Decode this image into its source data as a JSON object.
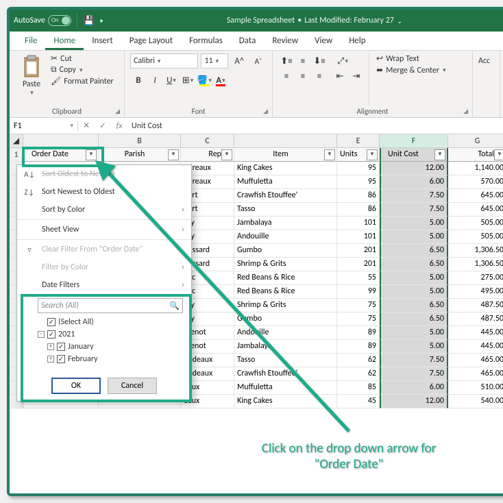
{
  "titlebar": {
    "autosave": "AutoSave",
    "toggle_state": "On",
    "doc_name": "Sample Spreadsheet",
    "modified": "Last Modified: February 27"
  },
  "menu": {
    "file": "File",
    "home": "Home",
    "insert": "Insert",
    "pagelayout": "Page Layout",
    "formulas": "Formulas",
    "data": "Data",
    "review": "Review",
    "view": "View",
    "help": "Help"
  },
  "ribbon": {
    "paste": "Paste",
    "cut": "Cut",
    "copy": "Copy",
    "format_painter": "Format Painter",
    "clipboard": "Clipboard",
    "font_name": "Calibri",
    "font_size": "11",
    "font_group": "Font",
    "wrap": "Wrap Text",
    "merge": "Merge & Center",
    "align_group": "Alignment",
    "acc": "Acc"
  },
  "fx": {
    "cell": "F1",
    "value": "Unit Cost"
  },
  "cols": {
    "b": "B",
    "c": "C",
    "e": "E",
    "f": "F",
    "g": "G"
  },
  "headers": {
    "order_date": "Order Date",
    "parish": "Parish",
    "rep": "Rep",
    "item": "Item",
    "units": "Units",
    "unit_cost": "Unit Cost",
    "total": "Total"
  },
  "rows": [
    {
      "rep": "udreaux",
      "item": "King Cakes",
      "units": 95,
      "cost": "12.00",
      "total": "1,140.00"
    },
    {
      "rep": "udreaux",
      "item": "Muffuletta",
      "units": 95,
      "cost": "6.00",
      "total": "570.00"
    },
    {
      "rep": "bert",
      "item": "Crawfish Etouffee'",
      "units": 86,
      "cost": "7.50",
      "total": "645.00"
    },
    {
      "rep": "bert",
      "item": "Tasso",
      "units": 86,
      "cost": "7.50",
      "total": "645.00"
    },
    {
      "rep": "dry",
      "item": "Jambalaya",
      "units": 101,
      "cost": "5.00",
      "total": "505.00"
    },
    {
      "rep": "dry",
      "item": "Andouille",
      "units": 101,
      "cost": "5.00",
      "total": "505.00"
    },
    {
      "rep": "oussard",
      "item": "Gumbo",
      "units": 201,
      "cost": "6.50",
      "total": "1,306.50"
    },
    {
      "rep": "oussard",
      "item": "Shrimp & Grits",
      "units": 201,
      "cost": "6.50",
      "total": "1,306.50"
    },
    {
      "rep": "anc",
      "item": "Red Beans & Rice",
      "units": 55,
      "cost": "5.00",
      "total": "275.00"
    },
    {
      "rep": "anc",
      "item": "Red Beans & Rice",
      "units": 99,
      "cost": "5.00",
      "total": "495.00"
    },
    {
      "rep": "dry",
      "item": "Shrimp & Grits",
      "units": 75,
      "cost": "6.50",
      "total": "487.50"
    },
    {
      "rep": "dry",
      "item": "Gumbo",
      "units": 75,
      "cost": "6.50",
      "total": "487.50"
    },
    {
      "rep": "ntenot",
      "item": "Andouille",
      "units": 89,
      "cost": "5.00",
      "total": "445.00"
    },
    {
      "rep": "ntenot",
      "item": "Jambalaya",
      "units": 89,
      "cost": "5.00",
      "total": "445.00"
    },
    {
      "rep": "bodeaux",
      "item": "Tasso",
      "units": 62,
      "cost": "7.50",
      "total": "465.00"
    },
    {
      "rep": "bodeaux",
      "item": "Crawfish Etouffee'",
      "units": 62,
      "cost": "7.50",
      "total": "465.00"
    },
    {
      "rep": "eaux",
      "item": "Muffuletta",
      "units": 85,
      "cost": "6.00",
      "total": "510.00"
    },
    {
      "rep": "eaux",
      "item": "King Cakes",
      "units": 45,
      "cost": "12.00",
      "total": "540.00"
    }
  ],
  "dropdown": {
    "sort_asc": "Sort Oldest to Newest",
    "sort_desc": "Sort Newest to Oldest",
    "sort_color": "Sort by Color",
    "sheet_view": "Sheet View",
    "clear": "Clear Filter From \"Order Date\"",
    "filter_color": "Filter by Color",
    "date_filters": "Date Filters",
    "search_ph": "Search (All)",
    "select_all": "(Select All)",
    "year": "2021",
    "jan": "January",
    "feb": "February",
    "ok": "OK",
    "cancel": "Cancel"
  },
  "annotation": {
    "text1": "Click on the drop down arrow for",
    "text2": "\"Order Date\""
  }
}
